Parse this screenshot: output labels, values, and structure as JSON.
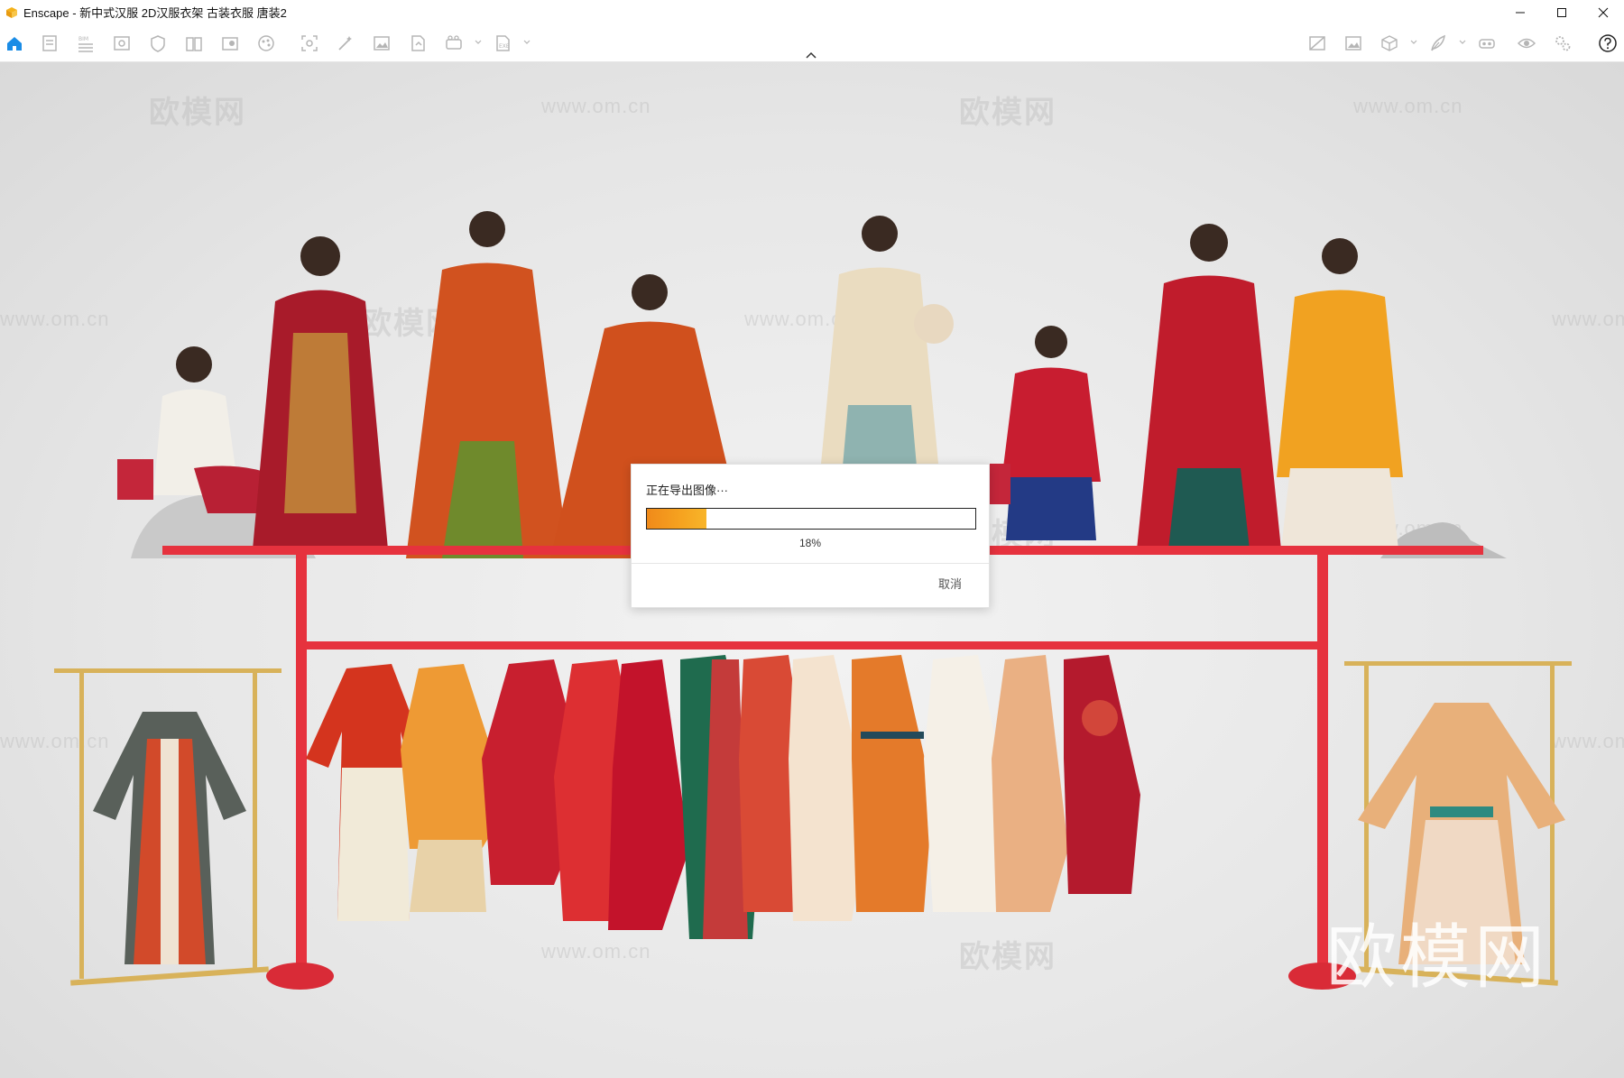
{
  "window": {
    "title": "Enscape - 新中式汉服 2D汉服衣架 古装衣服 唐装2",
    "controls": [
      "minimize-icon",
      "maximize-icon",
      "close-icon"
    ]
  },
  "toolbar": {
    "left_icons": [
      "home-icon",
      "sketch-icon",
      "bim-icon",
      "views-icon",
      "asset-shield-icon",
      "library-icon",
      "asset-library-icon",
      "materials-icon",
      "screenshot-icon",
      "batch-render-icon",
      "image-icon",
      "export-icon",
      "video-icon",
      "export-file-icon"
    ],
    "right_icons": [
      "compare-icon",
      "image-editor-icon",
      "cube-icon",
      "feather-icon",
      "vr-headset-icon",
      "eye-icon",
      "settings-icon",
      "help-icon"
    ],
    "accent": "#1a8ce6"
  },
  "viewport": {
    "watermarks": [
      "欧模网",
      "www.om.cn"
    ],
    "logo_watermark": "欧模网"
  },
  "dialog": {
    "title": "正在导出图像···",
    "progress_percent": 18,
    "progress_label": "18%",
    "cancel_label": "取消",
    "progress_color": "#f39a1f"
  }
}
